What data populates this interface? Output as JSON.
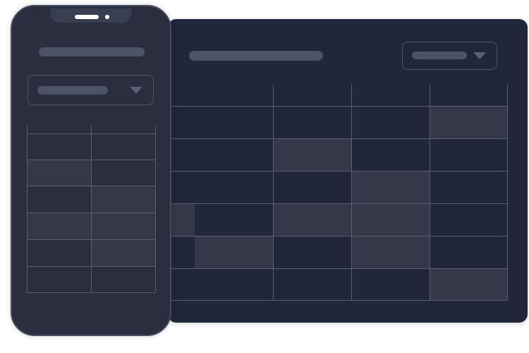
{
  "colors": {
    "desktop_bg": "#22263a",
    "phone_bg": "#2a2e3f",
    "placeholder": "#4d5266",
    "grid": "#5a5f72",
    "highlight": "#343849"
  },
  "desktop": {
    "title_placeholder": true,
    "dropdown_icon": "triangle-down-icon",
    "table": {
      "rows": 6,
      "cols": 5,
      "highlighted": [
        [
          0,
          4
        ],
        [
          1,
          2
        ],
        [
          2,
          3
        ],
        [
          3,
          0
        ],
        [
          3,
          2
        ],
        [
          3,
          3
        ],
        [
          4,
          1
        ],
        [
          4,
          3
        ],
        [
          5,
          4
        ]
      ]
    }
  },
  "phone": {
    "title_placeholder": true,
    "dropdown_icon": "triangle-down-icon",
    "table": {
      "rows": 6,
      "cols": 2,
      "highlighted": [
        [
          1,
          0
        ],
        [
          2,
          1
        ],
        [
          3,
          0
        ],
        [
          3,
          1
        ],
        [
          4,
          1
        ]
      ]
    }
  }
}
